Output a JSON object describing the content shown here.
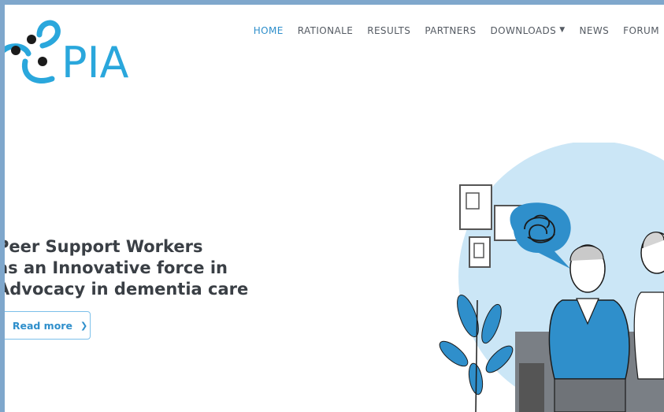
{
  "brand": {
    "logo_text": "PIA",
    "primary_color": "#2f8fcb"
  },
  "nav": {
    "items": [
      {
        "label": "HOME",
        "active": true
      },
      {
        "label": "RATIONALE"
      },
      {
        "label": "RESULTS"
      },
      {
        "label": "PARTNERS"
      },
      {
        "label": "DOWNLOADS",
        "dropdown": true
      },
      {
        "label": "NEWS"
      },
      {
        "label": "FORUM"
      }
    ]
  },
  "hero": {
    "title_lines": [
      "Peer Support Workers",
      "as an Innovative force in",
      "Advocacy in dementia care"
    ],
    "button_label": "Read more",
    "button_icon": "chevron-right-icon"
  }
}
